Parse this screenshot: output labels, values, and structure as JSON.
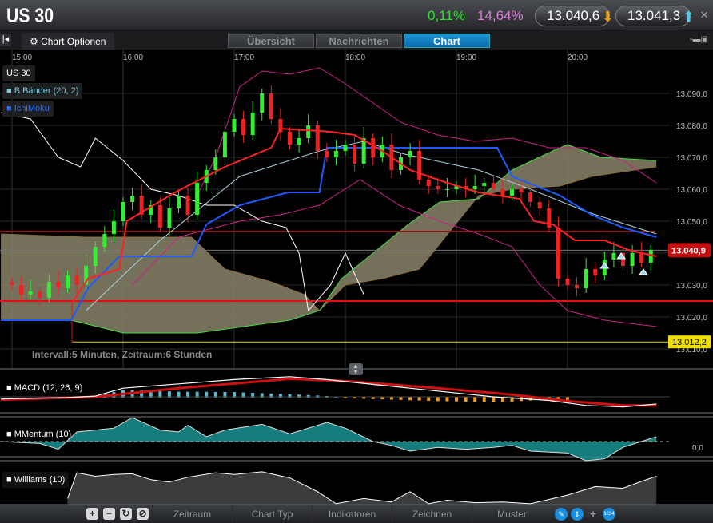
{
  "header": {
    "title": "US 30",
    "change_pct": "0,11%",
    "volatility_pct": "14,64%",
    "sell_price": "13.040,6",
    "buy_price": "13.041,3",
    "close": "×"
  },
  "tabs": {
    "back": "|◂",
    "chart_options": "Chart Optionen",
    "items": [
      {
        "label": "Übersicht",
        "active": false
      },
      {
        "label": "Nachrichten",
        "active": false
      },
      {
        "label": "Chart",
        "active": true
      }
    ],
    "window_icons": "▫▬▣"
  },
  "chart": {
    "time_labels": [
      "15:00",
      "16:00",
      "17:00",
      "18:00",
      "19:00",
      "20:00"
    ],
    "price_labels": [
      "13.090,0",
      "13.080,0",
      "13.070,0",
      "13.060,0",
      "13.050,0",
      "13.040,0",
      "13.030,0",
      "13.020,0",
      "13.010,0"
    ],
    "price_values": [
      13090,
      13080,
      13070,
      13060,
      13050,
      13040,
      13030,
      13020,
      13010
    ],
    "legend": {
      "symbol": "US 30",
      "bb": "B Bänder (20, 2)",
      "ichimoku": "IchiMoku"
    },
    "info": "Intervall:5 Minuten, Zeitraum:6 Stunden",
    "last_price_label": "13.040,9",
    "last_price": 13040.9,
    "yellow_line_label": "13.012,2",
    "yellow_line": 13012.2,
    "red_line": 13025,
    "colors": {
      "up": "#33ee33",
      "down": "#ee2222",
      "bb_outer": "#cc2288",
      "bb_mid": "#aad4e0",
      "tenkan": "#ff2222",
      "kijun": "#1a5cff",
      "chikou": "#ffffff",
      "cloud": "#8a8468",
      "span": "#44dd44"
    },
    "closes": [
      13030,
      13027,
      13028,
      13026,
      13031,
      13029,
      13033,
      13030,
      13036,
      13042,
      13046,
      13050,
      13056,
      13058,
      13052,
      13055,
      13048,
      13054,
      13058,
      13052,
      13062,
      13066,
      13070,
      13078,
      13082,
      13077,
      13084,
      13090,
      13082,
      13078,
      13074,
      13076,
      13080,
      13072,
      13070,
      13072,
      13074,
      13068,
      13076,
      13070,
      13074,
      13066,
      13070,
      13072,
      13063,
      13061,
      13060,
      13060,
      13061,
      13060,
      13061,
      13062,
      13060,
      13058,
      13060,
      13059,
      13056,
      13054,
      13048,
      13032,
      13030,
      13029,
      13035,
      13033,
      13038,
      13040,
      13036,
      13040,
      13037,
      13041
    ],
    "bb_upper": [
      [
        100,
        13058
      ],
      [
        110,
        13070
      ],
      [
        123,
        13092
      ],
      [
        135,
        13097
      ],
      [
        150,
        13096
      ],
      [
        166,
        13098
      ],
      [
        180,
        13093
      ],
      [
        195,
        13087
      ],
      [
        210,
        13081
      ],
      [
        230,
        13077
      ],
      [
        250,
        13075
      ],
      [
        270,
        13076
      ],
      [
        290,
        13073
      ],
      [
        310,
        13073
      ],
      [
        330,
        13069
      ],
      [
        348,
        13062
      ]
    ],
    "bb_lower": [
      [
        65,
        13030
      ],
      [
        90,
        13045
      ],
      [
        123,
        13050
      ],
      [
        145,
        13052
      ],
      [
        166,
        13055
      ],
      [
        188,
        13063
      ],
      [
        209,
        13055
      ],
      [
        231,
        13050
      ],
      [
        252,
        13046
      ],
      [
        270,
        13042
      ],
      [
        285,
        13030
      ],
      [
        300,
        13022
      ],
      [
        320,
        13019
      ],
      [
        348,
        13017
      ]
    ],
    "bb_mid": [
      [
        40,
        13022
      ],
      [
        80,
        13044
      ],
      [
        123,
        13064
      ],
      [
        166,
        13072
      ],
      [
        190,
        13075
      ],
      [
        212,
        13071
      ],
      [
        252,
        13066
      ],
      [
        280,
        13060
      ],
      [
        310,
        13053
      ],
      [
        348,
        13046
      ]
    ],
    "chikou": [
      [
        -6,
        13084
      ],
      [
        10,
        13082
      ],
      [
        25,
        13070
      ],
      [
        37,
        13067
      ],
      [
        45,
        13076
      ],
      [
        60,
        13069
      ],
      [
        75,
        13060
      ],
      [
        90,
        13058
      ],
      [
        105,
        13055
      ],
      [
        120,
        13055
      ],
      [
        135,
        13050
      ],
      [
        148,
        13048
      ],
      [
        155,
        13040
      ],
      [
        160,
        13022
      ],
      [
        172,
        13030
      ],
      [
        180,
        13040
      ],
      [
        190,
        13027
      ]
    ],
    "tenkan": [
      [
        32,
        13024
      ],
      [
        41,
        13032
      ],
      [
        58,
        13035
      ],
      [
        62,
        13050
      ],
      [
        88,
        13059
      ],
      [
        115,
        13067
      ],
      [
        140,
        13073
      ],
      [
        145,
        13079
      ],
      [
        172,
        13078
      ],
      [
        185,
        13077
      ],
      [
        200,
        13072
      ],
      [
        215,
        13066
      ],
      [
        235,
        13062
      ],
      [
        252,
        13059
      ],
      [
        274,
        13057
      ],
      [
        282,
        13050
      ],
      [
        292,
        13049
      ],
      [
        304,
        13044
      ],
      [
        320,
        13044
      ],
      [
        333,
        13041
      ],
      [
        348,
        13039
      ]
    ],
    "kijun": [
      [
        -6,
        13019
      ],
      [
        32,
        13019
      ],
      [
        41,
        13029
      ],
      [
        58,
        13039
      ],
      [
        97,
        13039
      ],
      [
        105,
        13049
      ],
      [
        123,
        13055
      ],
      [
        149,
        13059
      ],
      [
        166,
        13059
      ],
      [
        170,
        13073
      ],
      [
        227,
        13073
      ],
      [
        262,
        13073
      ],
      [
        270,
        13064
      ],
      [
        296,
        13058
      ],
      [
        313,
        13052
      ],
      [
        330,
        13048
      ],
      [
        348,
        13045
      ]
    ],
    "span_a": [
      [
        -6,
        13046
      ],
      [
        40,
        13045
      ],
      [
        97,
        13045
      ],
      [
        115,
        13035
      ],
      [
        140,
        13031
      ],
      [
        158,
        13027
      ],
      [
        166,
        13022
      ],
      [
        180,
        13030
      ],
      [
        200,
        13032
      ],
      [
        220,
        13035
      ],
      [
        252,
        13058
      ],
      [
        270,
        13060
      ],
      [
        296,
        13061
      ],
      [
        313,
        13064
      ],
      [
        348,
        13067
      ]
    ],
    "span_b": [
      [
        -6,
        13019
      ],
      [
        32,
        13019
      ],
      [
        60,
        13015
      ],
      [
        100,
        13015
      ],
      [
        150,
        13019
      ],
      [
        166,
        13022
      ],
      [
        178,
        13032
      ],
      [
        195,
        13040
      ],
      [
        214,
        13049
      ],
      [
        231,
        13056
      ],
      [
        252,
        13057
      ],
      [
        270,
        13066
      ],
      [
        292,
        13072
      ],
      [
        300,
        13074
      ],
      [
        318,
        13070
      ],
      [
        348,
        13069
      ]
    ]
  },
  "macd": {
    "label": "MACD (12, 26, 9)",
    "line": [
      [
        -6,
        -0.3
      ],
      [
        30,
        -0.1
      ],
      [
        45,
        0.1
      ],
      [
        60,
        1.2
      ],
      [
        90,
        1.8
      ],
      [
        120,
        2.4
      ],
      [
        150,
        2.8
      ],
      [
        170,
        2.4
      ],
      [
        200,
        1.6
      ],
      [
        230,
        0.8
      ],
      [
        260,
        0.0
      ],
      [
        290,
        -0.5
      ],
      [
        310,
        -1.2
      ],
      [
        330,
        -1.4
      ],
      [
        348,
        -1.0
      ]
    ],
    "signal": [
      [
        -6,
        -0.4
      ],
      [
        45,
        0
      ],
      [
        90,
        1.2
      ],
      [
        150,
        2.5
      ],
      [
        180,
        2.2
      ],
      [
        230,
        1.2
      ],
      [
        270,
        0.3
      ],
      [
        300,
        -0.6
      ],
      [
        330,
        -1.2
      ],
      [
        348,
        -1.2
      ]
    ]
  },
  "momentum": {
    "label": "MMentum (10)",
    "zero_label": "0,0",
    "values": [
      [
        -6,
        0
      ],
      [
        15,
        -2
      ],
      [
        25,
        -8
      ],
      [
        35,
        10
      ],
      [
        55,
        14
      ],
      [
        65,
        25
      ],
      [
        80,
        12
      ],
      [
        90,
        10
      ],
      [
        95,
        17
      ],
      [
        105,
        5
      ],
      [
        115,
        12
      ],
      [
        135,
        18
      ],
      [
        150,
        8
      ],
      [
        170,
        20
      ],
      [
        180,
        14
      ],
      [
        195,
        0
      ],
      [
        205,
        -4
      ],
      [
        215,
        -10
      ],
      [
        230,
        -6
      ],
      [
        245,
        -8
      ],
      [
        260,
        -6
      ],
      [
        270,
        -4
      ],
      [
        280,
        -10
      ],
      [
        300,
        -12
      ],
      [
        310,
        -20
      ],
      [
        320,
        -18
      ],
      [
        330,
        -6
      ],
      [
        348,
        5
      ]
    ]
  },
  "williams": {
    "label": "Williams (10)",
    "values": [
      [
        30,
        -80
      ],
      [
        35,
        -5
      ],
      [
        45,
        -15
      ],
      [
        55,
        -10
      ],
      [
        65,
        -8
      ],
      [
        75,
        -25
      ],
      [
        85,
        -32
      ],
      [
        95,
        -18
      ],
      [
        110,
        -5
      ],
      [
        120,
        -10
      ],
      [
        135,
        -2
      ],
      [
        150,
        -20
      ],
      [
        165,
        -60
      ],
      [
        175,
        -95
      ],
      [
        190,
        -80
      ],
      [
        205,
        -90
      ],
      [
        215,
        -60
      ],
      [
        225,
        -95
      ],
      [
        235,
        -85
      ],
      [
        250,
        -92
      ],
      [
        265,
        -90
      ],
      [
        280,
        -95
      ],
      [
        300,
        -70
      ],
      [
        315,
        -45
      ],
      [
        330,
        -50
      ],
      [
        340,
        -30
      ],
      [
        348,
        -15
      ]
    ]
  },
  "toolbar": {
    "zoom_in": "+",
    "zoom_out": "−",
    "refresh": "↻",
    "clear": "⊘",
    "menus": [
      "Zeitraum",
      "Chart Typ",
      "Indikatoren",
      "Zeichnen",
      "Muster"
    ],
    "counter": "1234"
  }
}
